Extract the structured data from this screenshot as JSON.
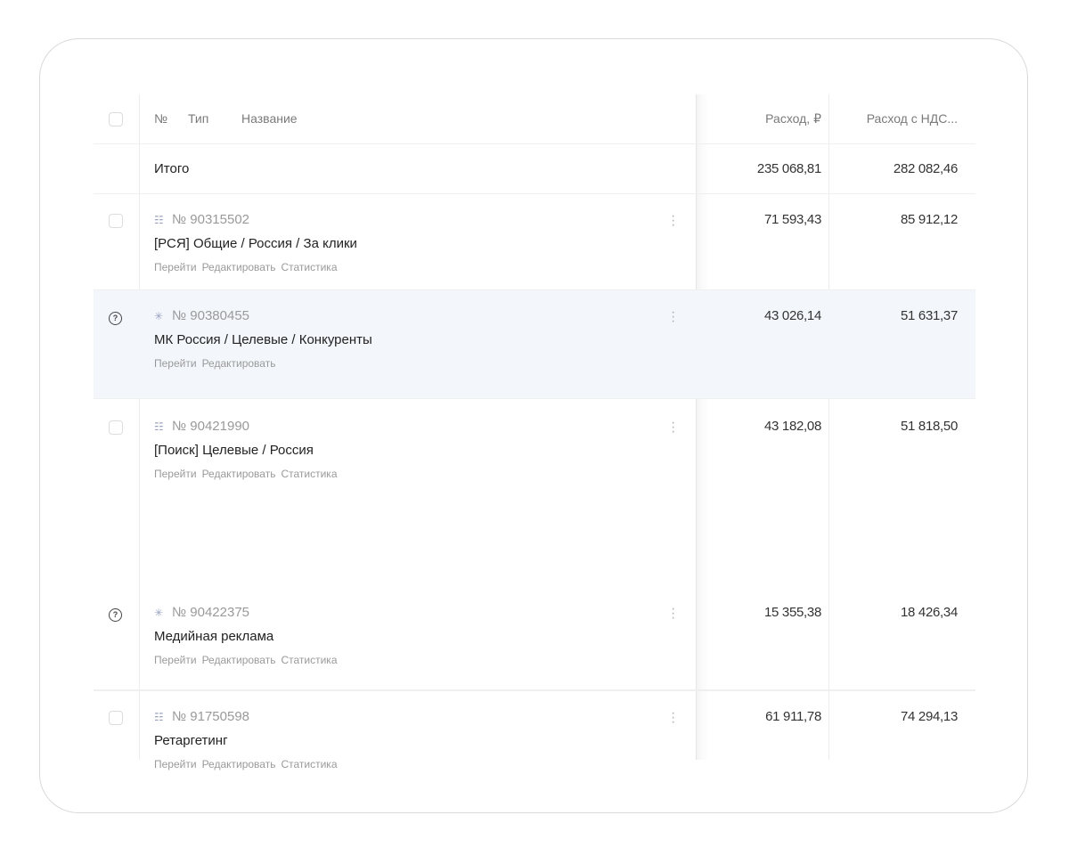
{
  "header": {
    "number": "№",
    "type": "Тип",
    "name": "Название",
    "spend": "Расход, ₽",
    "spend_vat": "Расход с НДС..."
  },
  "total": {
    "label": "Итого",
    "spend": "235 068,81",
    "spend_vat": "282 082,46"
  },
  "actions": {
    "go": "Перейти",
    "edit": "Редактировать",
    "stats": "Статистика"
  },
  "rows": [
    {
      "type_icon": "text-ad-icon",
      "id": "№ 90315502",
      "name": "[РСЯ] Общие / Россия / За клики",
      "spend": "71 593,43",
      "spend_vat": "85 912,12"
    },
    {
      "type_icon": "master-campaign-icon",
      "id": "№ 90380455",
      "name": "МК Россия / Целевые / Конкуренты",
      "spend": "43 026,14",
      "spend_vat": "51 631,37"
    },
    {
      "type_icon": "text-ad-icon",
      "id": "№ 90421990",
      "name": "[Поиск] Целевые / Россия",
      "spend": "43 182,08",
      "spend_vat": "51 818,50"
    },
    {
      "type_icon": "master-campaign-icon",
      "id": "№ 90422375",
      "name": "Медийная реклама",
      "spend": "15 355,38",
      "spend_vat": "18 426,34"
    },
    {
      "type_icon": "text-ad-icon",
      "id": "№ 91750598",
      "name": "Ретаргетинг",
      "spend": "61 911,78",
      "spend_vat": "74 294,13"
    }
  ]
}
